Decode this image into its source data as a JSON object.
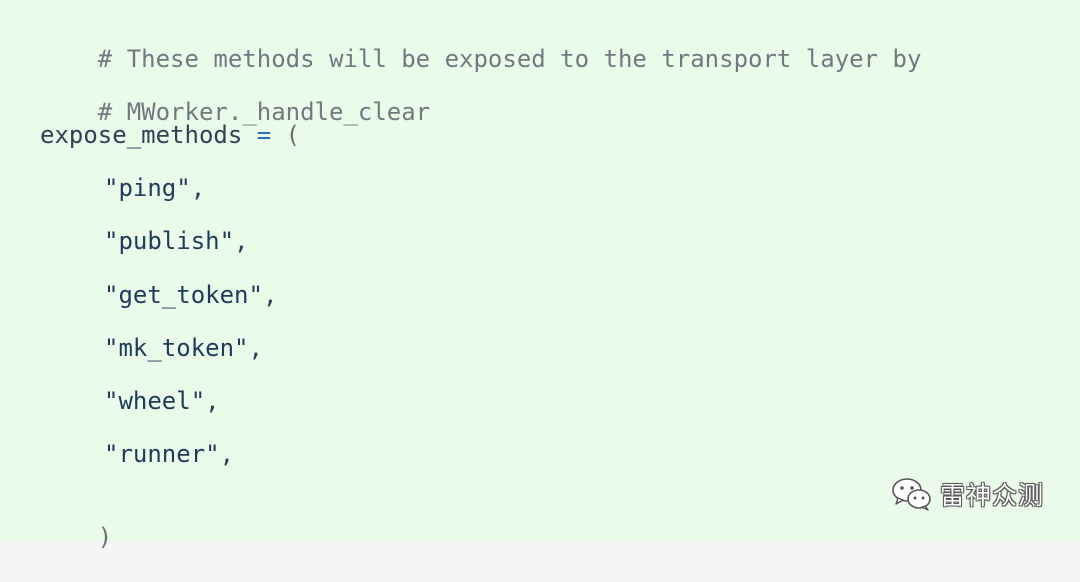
{
  "code": {
    "comment1": "# These methods will be exposed to the transport layer by",
    "comment2": "# MWorker._handle_clear",
    "assign_name": "expose_methods",
    "assign_op": "=",
    "open_paren": "(",
    "items": [
      "\"ping\"",
      "\"publish\"",
      "\"get_token\"",
      "\"mk_token\"",
      "\"wheel\"",
      "\"runner\""
    ],
    "comma": ",",
    "close_paren": ")"
  },
  "watermark": {
    "icon": "wechat-icon",
    "text": "雷神众测"
  },
  "colors": {
    "background": "#ebfbea",
    "comment": "#707a80",
    "operator": "#2f6fb5",
    "text": "#2b3f55"
  }
}
